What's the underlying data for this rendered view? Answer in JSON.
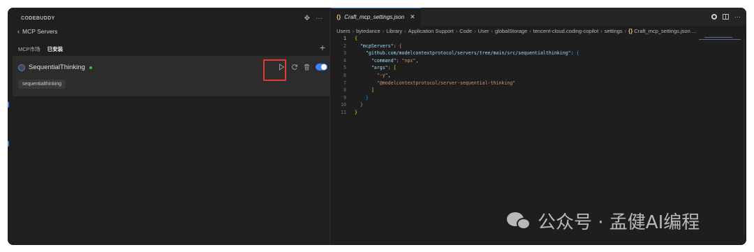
{
  "sidebar": {
    "title": "CODEBUDDY",
    "back_label": "MCP Servers",
    "tabs": [
      {
        "label": "MCP市场",
        "active": false
      },
      {
        "label": "已安装",
        "active": true
      }
    ],
    "add_icon": "plus-icon",
    "server": {
      "name": "SequentialThinking",
      "status": "running",
      "status_color": "#4caf50",
      "tag": "sequentialthinking",
      "enabled": true
    }
  },
  "editor": {
    "tab_label": "Craft_mcp_settings.json",
    "tab_icon": "{}",
    "breadcrumb": [
      "Users",
      "bytedance",
      "Library",
      "Application Support",
      "Code",
      "User",
      "globalStorage",
      "tencent-cloud.coding-copilot",
      "settings",
      "Craft_mcp_settings.json ..."
    ],
    "line_numbers": [
      "1",
      "2",
      "3",
      "4",
      "5",
      "6",
      "7",
      "8",
      "9",
      "10",
      "11"
    ],
    "code": {
      "l1": "{",
      "l2_key": "\"mcpServers\"",
      "l3_key": "\"github.com/modelcontextprotocol/servers/tree/main/src/sequentialthinking\"",
      "l4_key": "\"command\"",
      "l4_val": "\"npx\"",
      "l5_key": "\"args\"",
      "l6_val": "\"-y\"",
      "l7_val": "\"@modelcontextprotocol/server-sequential-thinking\""
    }
  },
  "watermark": {
    "text": "公众号 · 孟健AI编程"
  },
  "colors": {
    "accent": "#3b82f6",
    "highlight_box": "#e53935"
  }
}
